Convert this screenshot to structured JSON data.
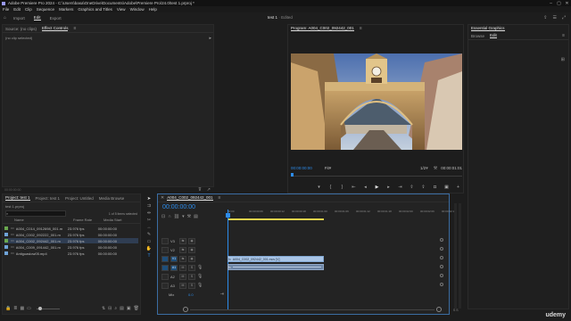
{
  "window": {
    "title": "Adobe Premiere Pro 2024 - C:\\Users\\basa\\OneDrive\\Documents\\Adobe\\Premiere Pro\\24.0\\test 1.prproj *"
  },
  "menu": [
    "File",
    "Edit",
    "Clip",
    "Sequence",
    "Markers",
    "Graphics and Titles",
    "View",
    "Window",
    "Help"
  ],
  "workspace": {
    "tabs": [
      "Import",
      "Edit",
      "Export"
    ],
    "active": "Edit",
    "center": [
      "test 1",
      "Edited"
    ]
  },
  "source_panel": {
    "tabs": [
      "Source: (no clips)",
      "Effect Controls"
    ],
    "active": "Effect Controls",
    "message": "(no clip selected)"
  },
  "program": {
    "title": "Program: A004_C002_092442_001",
    "timecode_left": "00:00:00:00",
    "fit": "Fit",
    "quality": "1/2",
    "timecode_right": "00:00:01:01"
  },
  "essential_graphics": {
    "title": "Essential Graphics",
    "tabs": [
      "Browse",
      "Edit"
    ],
    "active": "Edit"
  },
  "project": {
    "tabs": [
      "Project: test 1",
      "Project: test 1",
      "Project: Untitled",
      "Media Browse"
    ],
    "path": "test 1.prproj",
    "count": "1 of 5 items selected",
    "columns": [
      "Name",
      "Frame Rate",
      "Media Start"
    ],
    "items": [
      {
        "name": "A004_C014_0912698_001.m",
        "rate": "23.976 fps",
        "start": "00:00:00:00",
        "color": "#6aa84f"
      },
      {
        "name": "A004_C002_092222_001.m",
        "rate": "23.976 fps",
        "start": "00:00:00:00",
        "color": "#6fa3d8"
      },
      {
        "name": "A004_C002_092442_001.m",
        "rate": "23.976 fps",
        "start": "00:00:00:00",
        "color": "#6aa84f"
      },
      {
        "name": "A004_C009_091442_001.m",
        "rate": "23.976 fps",
        "start": "00:00:00:00",
        "color": "#6fa3d8"
      },
      {
        "name": "Antiguaslow05.mp4",
        "rate": "23.976 fps",
        "start": "00:00:00:00",
        "color": "#6fa3d8"
      }
    ]
  },
  "timeline": {
    "sequence_tab": "A004_C002_092442_001",
    "timecode": "00:00:00:00",
    "ruler": [
      "00:00",
      "00:00:00:06",
      "00:00:00:12",
      "00:00:00:18",
      "00:00:01:00",
      "00:00:01:06",
      "00:00:01:12",
      "00:00:01:18",
      "00:00:02:00",
      "00:00:02:06",
      "00:00:02:12"
    ],
    "tracks": {
      "video": [
        "V3",
        "V2",
        "V1"
      ],
      "audio": [
        "A1",
        "A2",
        "A3"
      ],
      "mix": "Mix",
      "mix_value": "0.0"
    },
    "clip_label": "A004_C002_092442_001.mov [V]"
  },
  "watermark": "udemy",
  "colors": {
    "accent": "#2d8ceb",
    "video_clip": "#a9c5e6",
    "audio_clip": "#6e86a6",
    "yellow": "#e3d24c"
  }
}
